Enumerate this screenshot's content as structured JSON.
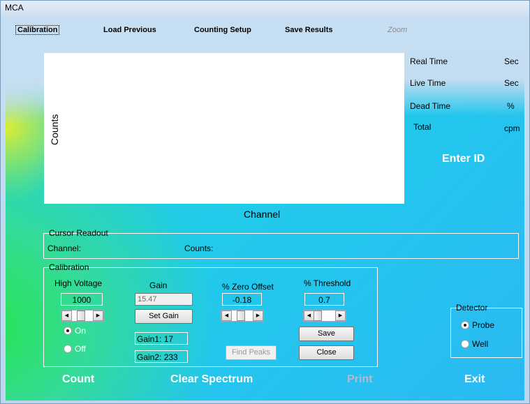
{
  "window": {
    "title": "MCA"
  },
  "menu": [
    {
      "label": "Calibration"
    },
    {
      "label": "Load Previous"
    },
    {
      "label": "Counting Setup"
    },
    {
      "label": "Save Results"
    },
    {
      "label": "Zoom"
    }
  ],
  "plot": {
    "ylabel": "Counts",
    "xlabel": "Channel"
  },
  "stats": {
    "real_time_label": "Real Time",
    "real_time_unit": "Sec",
    "live_time_label": "Live Time",
    "live_time_unit": "Sec",
    "dead_time_label": "Dead Time",
    "dead_time_unit": "%",
    "total_label": "Total",
    "total_unit": "cpm"
  },
  "enter_id": "Enter ID",
  "cursor_readout": {
    "title": "Cursor Readout",
    "channel_label": "Channel:",
    "counts_label": "Counts:"
  },
  "calibration": {
    "title": "Calibration",
    "high_voltage_label": "High Voltage",
    "high_voltage_value": "1000",
    "hv_on_label": "On",
    "hv_off_label": "Off",
    "gain_label": "Gain",
    "gain_value": "15.47",
    "set_gain_label": "Set Gain",
    "gain1": "Gain1: 17",
    "gain2": "Gain2: 233",
    "zero_offset_label": "% Zero Offset",
    "zero_offset_value": "-0.18",
    "find_peaks_label": "Find Peaks",
    "threshold_label": "% Threshold",
    "threshold_value": "0.7",
    "save_label": "Save",
    "close_label": "Close"
  },
  "detector": {
    "title": "Detector",
    "probe_label": "Probe",
    "well_label": "Well",
    "selected": "Probe"
  },
  "buttons": {
    "count": "Count",
    "clear_spectrum": "Clear Spectrum",
    "print": "Print",
    "exit": "Exit"
  }
}
